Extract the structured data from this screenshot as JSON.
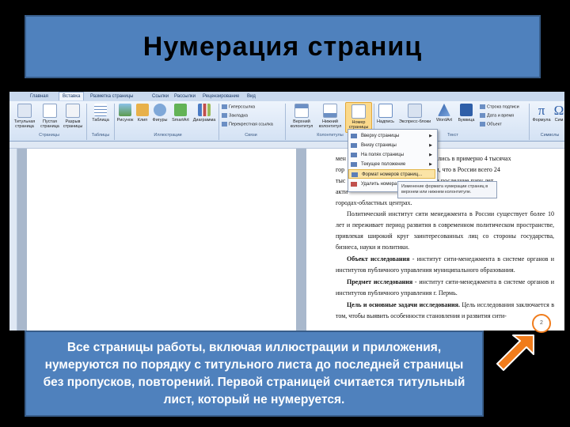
{
  "slide": {
    "title": "Нумерация страниц",
    "caption": "Все страницы работы, включая иллюстрации и приложения, нумеруются по порядку с титульного листа до последней страницы без пропусков, повторений. Первой страницей считается титульный лист, который не нумеруется.",
    "page_number": "2"
  },
  "word": {
    "tabs": [
      "Главная",
      "Вставка",
      "Разметка страницы",
      "Ссылки",
      "Рассылки",
      "Рецензирование",
      "Вид"
    ],
    "active_tab": "Вставка",
    "ribbon": {
      "title_page": "Титульная страница",
      "blank_page": "Пустая страница",
      "page_break": "Разрыв страницы",
      "table": "Таблица",
      "picture": "Рисунок",
      "clip": "Клип",
      "shapes": "Фигуры",
      "smartart": "SmartArt",
      "chart": "Диаграмма",
      "hyperlink": "Гиперссылка",
      "bookmark": "Закладка",
      "cross_ref": "Перекрестная ссылка",
      "header": "Верхний колонтитул",
      "footer": "Нижний колонтитул",
      "page_number": "Номер страницы",
      "textbox": "Надпись",
      "quick_parts": "Экспресс-блоки",
      "wordart": "WordArt",
      "dropcap": "Буквица",
      "signature_line": "Строка подписи",
      "date_time": "Дата и время",
      "object": "Объект",
      "formula": "Формула",
      "symbol": "Сим"
    },
    "groups": {
      "pages": "Страницы",
      "tables": "Таблицы",
      "illustrations": "Иллюстрации",
      "links": "Связи",
      "headers": "Колонтитулы",
      "text": "Текст",
      "symbols": "Символы"
    },
    "menu": {
      "items": [
        "Вверху страницы",
        "Внизу страницы",
        "На полях страницы",
        "Текущее положение",
        "Формат номеров страниц...",
        "Удалить номера страниц"
      ],
      "highlighted": "Формат номеров страниц..."
    },
    "tooltip": "Изменение формата нумерации страниц в верхнем или нижнем колонтитуле.",
    "doc": {
      "p0_l1": "мен                                    джеры появились в примерно 4 тысячах",
      "p0_l2": "гор                                     . Это при том, что в России всего 24",
      "p0_l3": "тыс                                     . К тому же в последние пару лет",
      "p0_l4": "акти                                              ра в крупных",
      "p0_l5": "городах-областных центрах.",
      "p1": "Политический институт сити менеджмента в России существует более 10 лет и переживает период развития в современном политическом пространстве, привлекая широкий круг заинтересованных лиц со стороны государства, бизнеса, науки и политики.",
      "p2_b": "Объект исследования",
      "p2": " - институт сити-менеджмента в системе органов и институтов публичного управления муниципального образования.",
      "p3_b": "Предмет исследования",
      "p3": " - институт сити-менеджмента в системе органов и институтов публичного управления г. Пермь.",
      "p4_b": "Цель и основные задачи исследования.",
      "p4": " Цель исследования заключается в том, чтобы выявить особенности становления и развития сити-"
    }
  },
  "colors": {
    "accent": "#4f81bd",
    "arrow": "#f07c1c"
  }
}
